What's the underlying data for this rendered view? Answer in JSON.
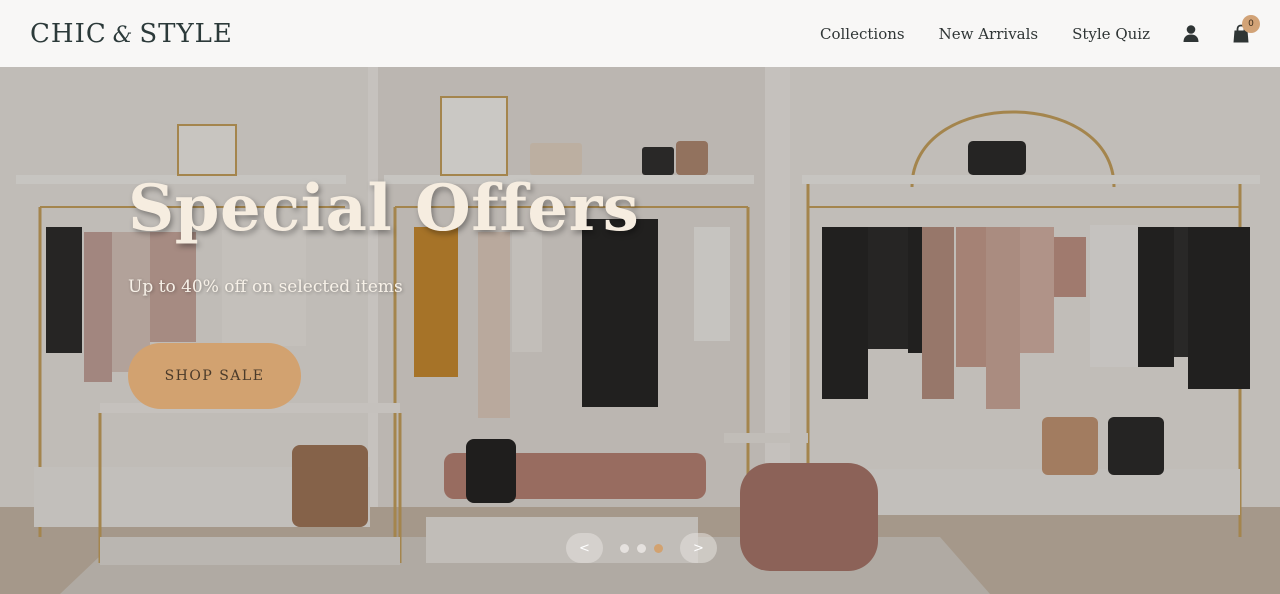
{
  "brand": {
    "logo_left": "CHIC",
    "logo_amp": "&",
    "logo_right": "STYLE"
  },
  "nav": {
    "links": [
      "Collections",
      "New Arrivals",
      "Style Quiz"
    ],
    "account_icon": "user-icon",
    "cart_icon": "shopping-bag-icon",
    "cart_count": "0"
  },
  "hero": {
    "title": "Special Offers",
    "subtitle": "Up to 40% off on selected items",
    "cta_label": "SHOP SALE",
    "prev_label": "<",
    "next_label": ">",
    "slide_count": 3,
    "active_slide": 3
  },
  "colors": {
    "accent": "#d2a270",
    "heading_text": "#f6ede0",
    "logo_text": "#2c3a3a"
  }
}
